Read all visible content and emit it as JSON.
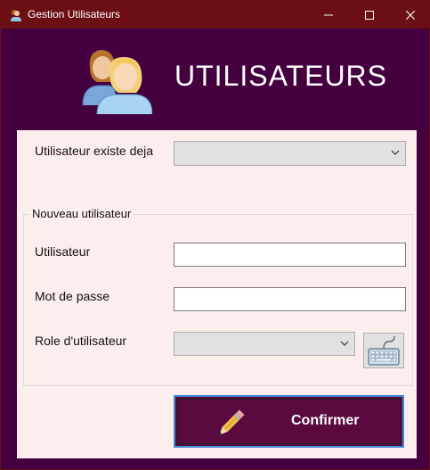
{
  "window": {
    "title": "Gestion Utilisateurs",
    "titlebar_color": "#6b0f14",
    "background_color": "#45003f"
  },
  "header": {
    "title": "UTILISATEURS",
    "icon": "users-icon"
  },
  "form": {
    "existing_user_label": "Utilisateur existe deja",
    "existing_user_value": "",
    "group_legend": "Nouveau utilisateur",
    "username_label": "Utilisateur",
    "username_value": "",
    "password_label": "Mot de passe",
    "password_value": "",
    "role_label": "Role d'utilisateur",
    "role_value": "",
    "keyboard_icon": "keyboard-icon"
  },
  "actions": {
    "confirm_label": "Confirmer",
    "confirm_icon": "pencil-icon",
    "confirm_bg": "#5a0a3e"
  }
}
